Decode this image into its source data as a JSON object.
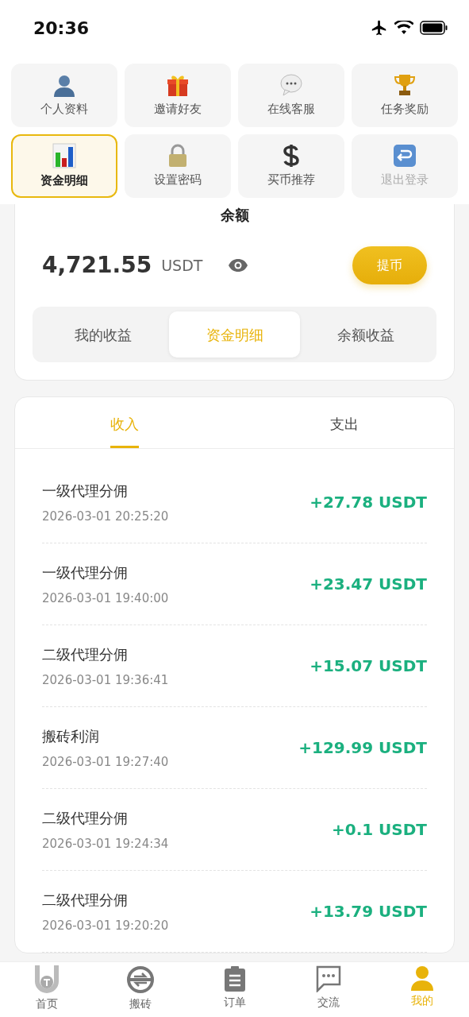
{
  "status_bar": {
    "time": "20:36"
  },
  "menu": [
    {
      "label": "个人资料",
      "selected": false,
      "dimmed": false
    },
    {
      "label": "邀请好友",
      "selected": false,
      "dimmed": false
    },
    {
      "label": "在线客服",
      "selected": false,
      "dimmed": false
    },
    {
      "label": "任务奖励",
      "selected": false,
      "dimmed": false
    },
    {
      "label": "资金明细",
      "selected": true,
      "dimmed": false
    },
    {
      "label": "设置密码",
      "selected": false,
      "dimmed": false
    },
    {
      "label": "买币推荐",
      "selected": false,
      "dimmed": false
    },
    {
      "label": "退出登录",
      "selected": false,
      "dimmed": true
    }
  ],
  "balance": {
    "title": "余额",
    "amount": "4,721.55",
    "unit": "USDT",
    "withdraw_button": "提币"
  },
  "segments": [
    {
      "label": "我的收益",
      "selected": false
    },
    {
      "label": "资金明细",
      "selected": true
    },
    {
      "label": "余额收益",
      "selected": false
    }
  ],
  "record_tabs": [
    {
      "label": "收入",
      "selected": true
    },
    {
      "label": "支出",
      "selected": false
    }
  ],
  "records": [
    {
      "title": "一级代理分佣",
      "time": "2026-03-01 20:25:20",
      "amount": "+27.78 USDT"
    },
    {
      "title": "一级代理分佣",
      "time": "2026-03-01 19:40:00",
      "amount": "+23.47 USDT"
    },
    {
      "title": "二级代理分佣",
      "time": "2026-03-01 19:36:41",
      "amount": "+15.07 USDT"
    },
    {
      "title": "搬砖利润",
      "time": "2026-03-01 19:27:40",
      "amount": "+129.99 USDT"
    },
    {
      "title": "二级代理分佣",
      "time": "2026-03-01 19:24:34",
      "amount": "+0.1 USDT"
    },
    {
      "title": "二级代理分佣",
      "time": "2026-03-01 19:20:20",
      "amount": "+13.79 USDT"
    }
  ],
  "tab_bar": [
    {
      "label": "首页",
      "selected": false
    },
    {
      "label": "搬砖",
      "selected": false
    },
    {
      "label": "订单",
      "selected": false
    },
    {
      "label": "交流",
      "selected": false
    },
    {
      "label": "我的",
      "selected": true
    }
  ]
}
